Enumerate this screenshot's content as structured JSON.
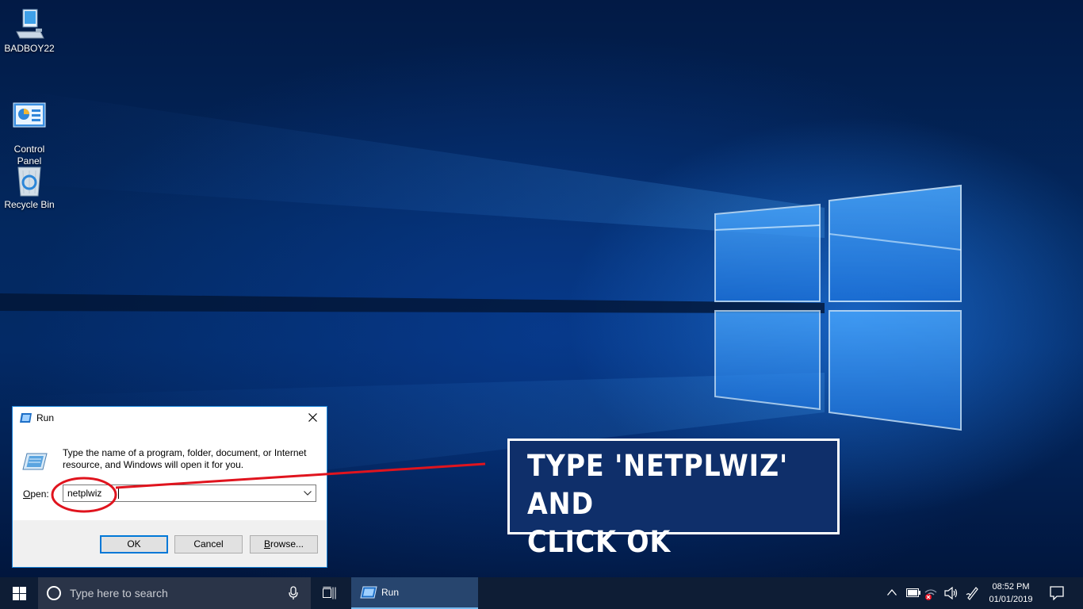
{
  "desktop": {
    "icons": [
      {
        "label": "BADBOY22",
        "icon": "computer-icon"
      },
      {
        "label": "Control\nPanel",
        "icon": "control-panel-icon"
      },
      {
        "label": "Recycle Bin",
        "icon": "recycle-bin-icon"
      }
    ]
  },
  "run_dialog": {
    "title": "Run",
    "description": "Type the name of a program, folder, document, or Internet resource, and Windows will open it for you.",
    "open_label_prefix": "",
    "open_label_access": "O",
    "open_label_rest": "pen:",
    "input_value": "netplwiz",
    "ok_label": "OK",
    "cancel_label": "Cancel",
    "browse_label_access": "B",
    "browse_label_rest": "rowse...",
    "close_icon": "close-icon"
  },
  "annotation": {
    "line1": "TYPE 'NETPLWIZ' AND",
    "line2": "CLICK OK",
    "highlight_color": "#e0141e"
  },
  "taskbar": {
    "search_placeholder": "Type here to search",
    "running_app": "Run",
    "clock_time": "08:52 PM",
    "clock_date": "01/01/2019",
    "accent": "#76b9ed"
  }
}
